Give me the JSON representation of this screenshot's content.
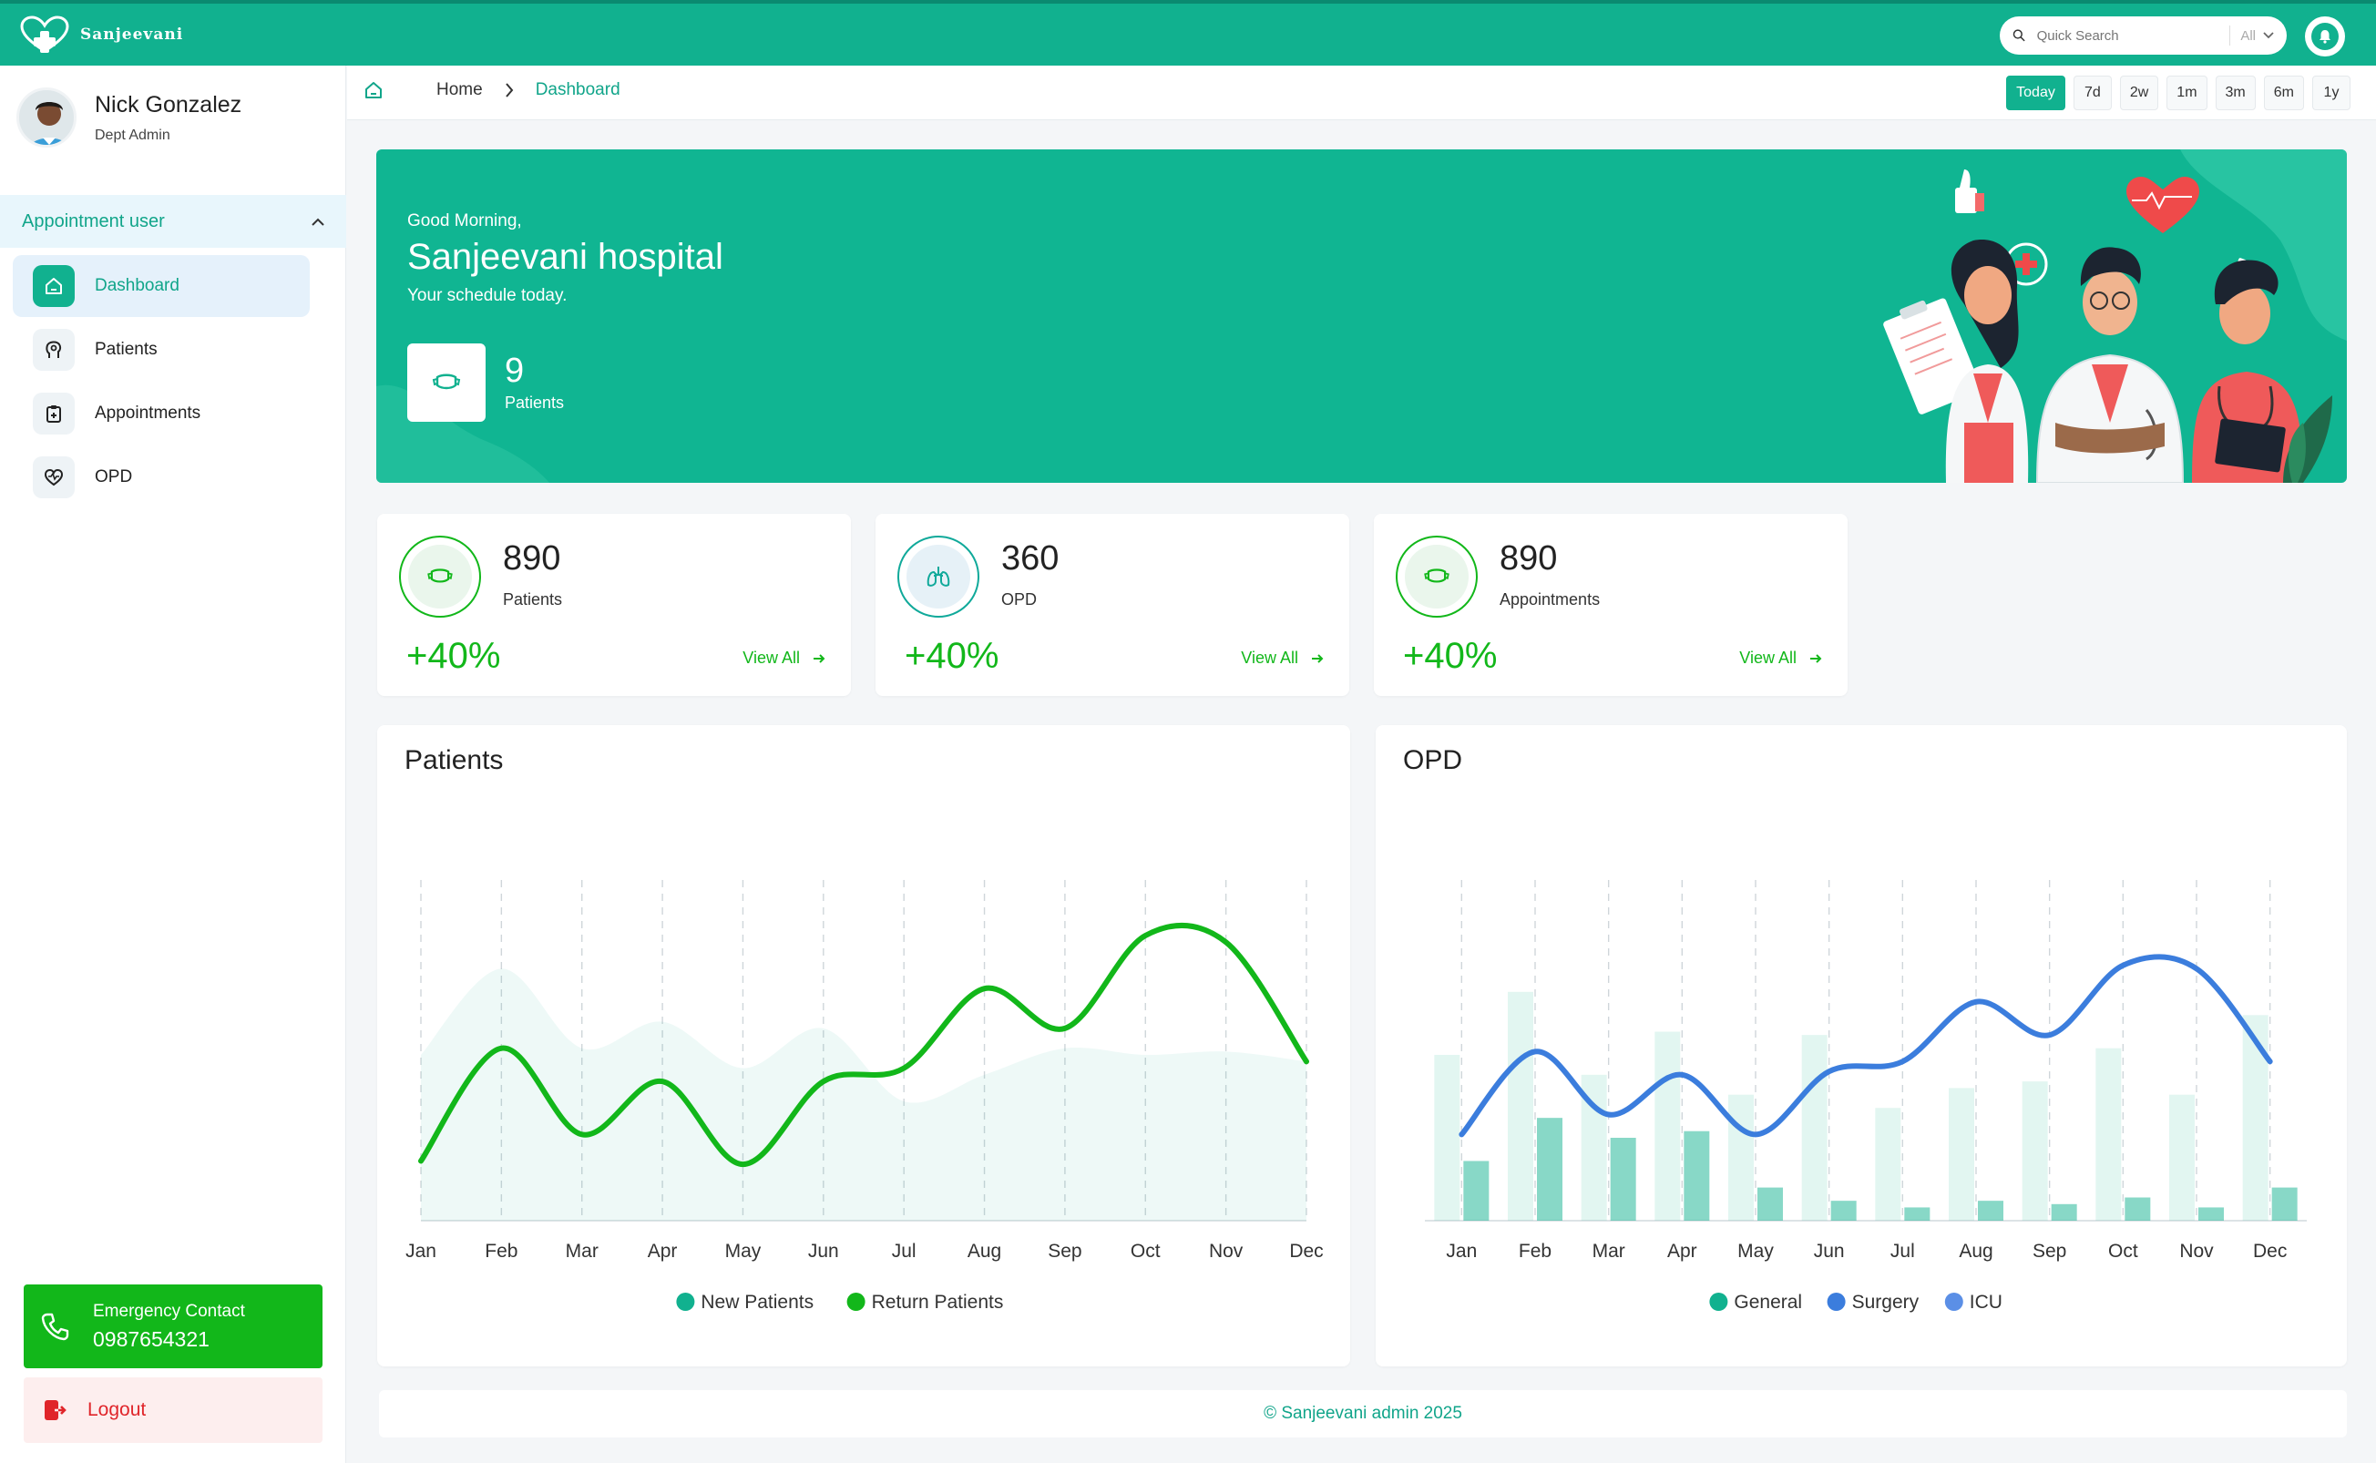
{
  "brand": {
    "name": "Sanjeevani"
  },
  "search": {
    "placeholder": "Quick Search",
    "scope": "All"
  },
  "user": {
    "name": "Nick Gonzalez",
    "role": "Dept Admin"
  },
  "menu": {
    "section": "Appointment user",
    "items": [
      {
        "label": "Dashboard",
        "icon": "home-icon",
        "active": true
      },
      {
        "label": "Patients",
        "icon": "patient-icon"
      },
      {
        "label": "Appointments",
        "icon": "clipboard-icon"
      },
      {
        "label": "OPD",
        "icon": "heart-pulse-icon"
      }
    ]
  },
  "emergency": {
    "label": "Emergency Contact",
    "phone": "0987654321"
  },
  "logout": {
    "label": "Logout"
  },
  "breadcrumb": {
    "home": "Home",
    "current": "Dashboard"
  },
  "ranges": [
    "Today",
    "7d",
    "2w",
    "1m",
    "3m",
    "6m",
    "1y"
  ],
  "active_range": "Today",
  "hero": {
    "greeting": "Good Morning,",
    "title": "Sanjeevani hospital",
    "subtitle": "Your schedule today.",
    "count": "9",
    "count_label": "Patients"
  },
  "stats": [
    {
      "value": "890",
      "label": "Patients",
      "change": "+40%",
      "link": "View All"
    },
    {
      "value": "360",
      "label": "OPD",
      "change": "+40%",
      "link": "View All"
    },
    {
      "value": "890",
      "label": "Appointments",
      "change": "+40%",
      "link": "View All"
    }
  ],
  "colors": {
    "primary": "#11b18f",
    "green": "#12b71a",
    "surgery_blue": "#3b7ddd",
    "icu_blue": "#5b8fe6",
    "danger": "#e0252a"
  },
  "chart_data": [
    {
      "type": "line",
      "title": "Patients",
      "categories": [
        "Jan",
        "Feb",
        "Mar",
        "Apr",
        "May",
        "Jun",
        "Jul",
        "Aug",
        "Sep",
        "Oct",
        "Nov",
        "Dec"
      ],
      "ylim": [
        0,
        100
      ],
      "series": [
        {
          "name": "New Patients",
          "kind": "area",
          "color": "#11b18f",
          "values": [
            50,
            76,
            52,
            60,
            46,
            58,
            36,
            44,
            52,
            50,
            51,
            48
          ]
        },
        {
          "name": "Return Patients",
          "kind": "line",
          "color": "#12b71a",
          "values": [
            18,
            52,
            26,
            42,
            17,
            42,
            46,
            70,
            58,
            86,
            84,
            48
          ]
        }
      ],
      "grid": true,
      "legend": "bottom"
    },
    {
      "type": "bar",
      "title": "OPD",
      "categories": [
        "Jan",
        "Feb",
        "Mar",
        "Apr",
        "May",
        "Jun",
        "Jul",
        "Aug",
        "Sep",
        "Oct",
        "Nov",
        "Dec"
      ],
      "ylim": [
        0,
        100
      ],
      "series": [
        {
          "name": "General",
          "kind": "bar",
          "color": "#11b18f",
          "values": [
            50,
            69,
            44,
            57,
            38,
            56,
            34,
            40,
            42,
            52,
            38,
            62
          ]
        },
        {
          "name": "Surgery",
          "kind": "line",
          "color": "#3b7ddd",
          "values": [
            26,
            51,
            32,
            44,
            26,
            45,
            48,
            66,
            56,
            77,
            76,
            48
          ]
        },
        {
          "name": "ICU",
          "kind": "bar",
          "color": "#11b18f",
          "values": [
            18,
            31,
            25,
            27,
            10,
            6,
            4,
            6,
            5,
            7,
            4,
            10
          ]
        }
      ],
      "grid": true,
      "legend": "bottom"
    }
  ],
  "footer": {
    "text": "© Sanjeevani admin 2025"
  }
}
